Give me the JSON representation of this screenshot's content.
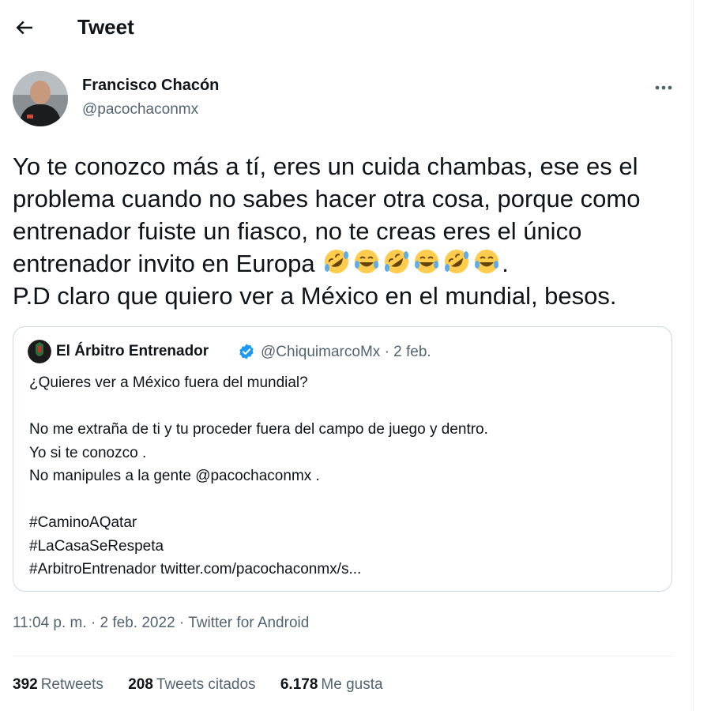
{
  "header": {
    "title": "Tweet",
    "back_icon": "arrow-left-icon"
  },
  "author": {
    "name": "Francisco Chacón",
    "handle": "@pacochaconmx"
  },
  "more_icon": "more-dots-icon",
  "tweet": {
    "text_main": "Yo te conozco más a tí, eres un cuida chambas, ese es el problema cuando no sabes hacer otra cosa, porque como entrenador fuiste un fiasco, no te creas eres el único entrenador invito en Europa",
    "emojis": [
      "rolling-on-floor-laughing",
      "face-with-tears-of-joy",
      "rolling-on-floor-laughing",
      "face-with-tears-of-joy",
      "rolling-on-floor-laughing",
      "face-with-tears-of-joy"
    ],
    "text_punct": ".",
    "text_end": "P.D claro que quiero ver a México en el mundial, besos."
  },
  "quote": {
    "name": "El Árbitro Entrenador",
    "verified_icon": "verified-badge-icon",
    "handle": "@ChiquimarcoMx",
    "separator": "·",
    "date": "2 feb.",
    "lines": [
      "¿Quieres ver a México fuera del mundial?",
      "",
      "No me extraña de ti y tu proceder fuera del campo de juego y dentro.",
      "Yo si te conozco .",
      "No manipules a la gente @pacochaconmx .",
      "",
      "#CaminoAQatar",
      "#LaCasaSeRespeta",
      "#ArbitroEntrenador twitter.com/pacochaconmx/s..."
    ]
  },
  "meta": {
    "time": "11:04 p. m.",
    "sep": "·",
    "date": "2 feb. 2022",
    "source": "Twitter for Android"
  },
  "stats": {
    "retweets_count": "392",
    "retweets_label": "Retweets",
    "quotes_count": "208",
    "quotes_label": "Tweets citados",
    "likes_count": "6.178",
    "likes_label": "Me gusta"
  },
  "colors": {
    "text": "#0f1419",
    "secondary": "#536471",
    "border": "#cfd9de",
    "verified": "#1d9bf0"
  }
}
